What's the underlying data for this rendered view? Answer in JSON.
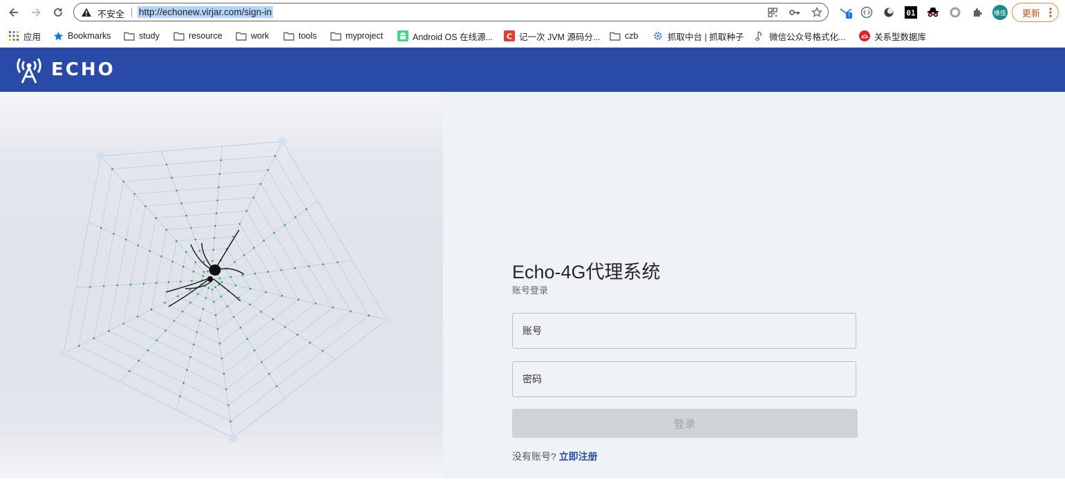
{
  "browser": {
    "security_label": "不安全",
    "url": "http://echonew.virjar.com/sign-in",
    "profile_label": "维佳",
    "update_label": "更新"
  },
  "bookmarks": [
    {
      "label": "应用",
      "icon": "apps-grid-icon"
    },
    {
      "label": "Bookmarks",
      "icon": "star-icon"
    },
    {
      "label": "study",
      "icon": "folder-icon"
    },
    {
      "label": "resource",
      "icon": "folder-icon"
    },
    {
      "label": "work",
      "icon": "folder-icon"
    },
    {
      "label": "tools",
      "icon": "folder-icon"
    },
    {
      "label": "myproject",
      "icon": "folder-icon"
    },
    {
      "label": "Android OS 在线源...",
      "icon": "android-icon"
    },
    {
      "label": "记一次 JVM 源码分...",
      "icon": "csdn-icon"
    },
    {
      "label": "czb",
      "icon": "folder-icon"
    },
    {
      "label": "抓取中台 | 抓取种子",
      "icon": "gear-icon"
    },
    {
      "label": "微信公众号格式化...",
      "icon": "music-note-icon"
    },
    {
      "label": "关系型数据库",
      "icon": "cloud-db-icon"
    }
  ],
  "app": {
    "logo_text": "ECHO",
    "colors": {
      "header": "#2a4aa8",
      "accent": "#2a4aa8"
    }
  },
  "login": {
    "title": "Echo-4G代理系统",
    "subtitle": "账号登录",
    "account_placeholder": "账号",
    "password_placeholder": "密码",
    "submit_label": "登录",
    "no_account_text": "没有账号?",
    "register_link": "立即注册"
  }
}
